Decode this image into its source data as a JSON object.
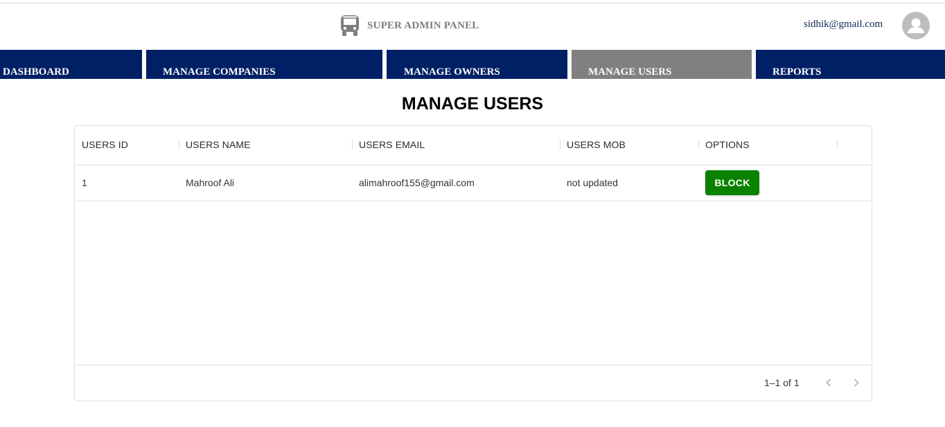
{
  "header": {
    "brand_title": "SUPER ADMIN PANEL",
    "brand_icon": "bus-icon",
    "account_email": "sidhik@gmail.com",
    "avatar_icon": "person-icon"
  },
  "nav": {
    "tabs": [
      {
        "label": "DASHBOARD",
        "active": false
      },
      {
        "label": "MANAGE COMPANIES",
        "active": false
      },
      {
        "label": "MANAGE OWNERS",
        "active": false
      },
      {
        "label": "MANAGE USERS",
        "active": true
      },
      {
        "label": "REPORTS",
        "active": false
      }
    ]
  },
  "page": {
    "title": "MANAGE USERS"
  },
  "table": {
    "columns": [
      "USERS ID",
      "USERS NAME",
      "USERS EMAIL",
      "USERS MOB",
      "OPTIONS"
    ],
    "rows": [
      {
        "id": "1",
        "name": "Mahroof Ali",
        "email": "alimahroof155@gmail.com",
        "mob": "not updated",
        "action_label": "BLOCK"
      }
    ],
    "pagination": {
      "range_text": "1–1 of 1",
      "prev_icon": "chevron-left-icon",
      "next_icon": "chevron-right-icon"
    }
  },
  "colors": {
    "nav_background": "#002065",
    "nav_active_background": "#808080",
    "block_button": "#0a8200",
    "brand_text": "#7d7d7d",
    "email_text": "#12245c"
  }
}
